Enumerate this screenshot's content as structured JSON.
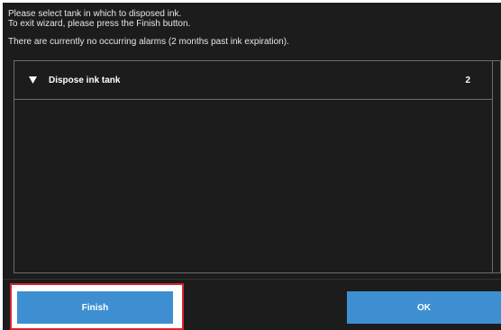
{
  "instructions": {
    "line1": "Please select tank in which to disposed ink.",
    "line2": "To exit wizard, please press the Finish button.",
    "line3": "There are currently no occurring alarms (2 months past ink expiration)."
  },
  "list": {
    "group": {
      "expanded": true,
      "toggle_icon": "triangle-down-icon",
      "title": "Dispose ink tank",
      "count": "2"
    }
  },
  "buttons": {
    "finish_label": "Finish",
    "ok_label": "OK"
  },
  "colors": {
    "background": "#1c1c1c",
    "button": "#3d8fd1",
    "highlight": "#d8262b",
    "border": "#6c6c6c"
  }
}
